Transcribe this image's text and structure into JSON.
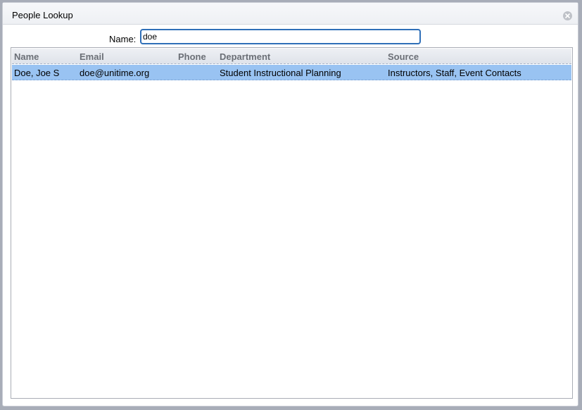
{
  "dialog": {
    "title": "People Lookup",
    "close_icon": "close-circle-icon"
  },
  "search": {
    "label": "Name:",
    "value": "doe"
  },
  "table": {
    "columns": [
      "Name",
      "Email",
      "Phone",
      "Department",
      "Source"
    ],
    "rows": [
      {
        "name": "Doe, Joe S",
        "email": "doe@unitime.org",
        "phone": "",
        "department": "Student Instructional Planning",
        "source": "Instructors, Staff, Event Contacts",
        "selected": true
      }
    ]
  },
  "colors": {
    "selected_row": "#99c3f2",
    "input_focus_border": "#2f6fb8",
    "header_text": "#6b6f76"
  }
}
